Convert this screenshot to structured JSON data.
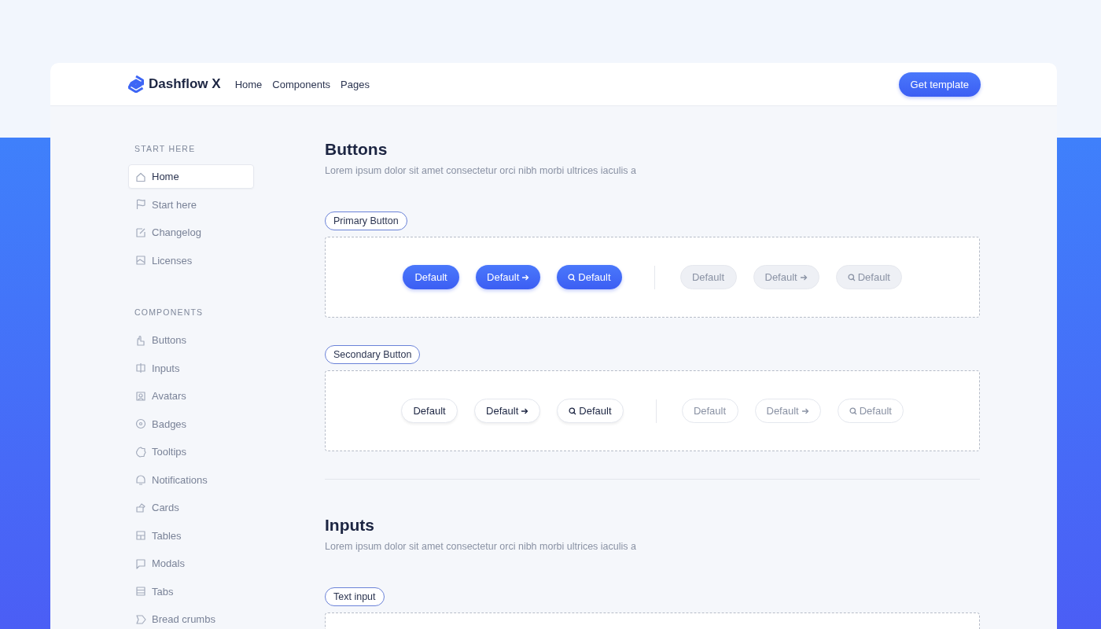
{
  "brand": {
    "name": "Dashflow X"
  },
  "nav": [
    {
      "label": "Home"
    },
    {
      "label": "Components"
    },
    {
      "label": "Pages"
    }
  ],
  "cta": {
    "label": "Get template"
  },
  "sidebar": [
    {
      "heading": "START HERE",
      "items": [
        {
          "label": "Home",
          "selected": true
        },
        {
          "label": "Start here",
          "selected": false
        },
        {
          "label": "Changelog",
          "selected": false
        },
        {
          "label": "Licenses",
          "selected": false
        }
      ]
    },
    {
      "heading": "COMPONENTS",
      "items": [
        {
          "label": "Buttons",
          "selected": false
        },
        {
          "label": "Inputs",
          "selected": false
        },
        {
          "label": "Avatars",
          "selected": false
        },
        {
          "label": "Badges",
          "selected": false
        },
        {
          "label": "Tooltips",
          "selected": false
        },
        {
          "label": "Notifications",
          "selected": false
        },
        {
          "label": "Cards",
          "selected": false
        },
        {
          "label": "Tables",
          "selected": false
        },
        {
          "label": "Modals",
          "selected": false
        },
        {
          "label": "Tabs",
          "selected": false
        },
        {
          "label": "Bread crumbs",
          "selected": false
        }
      ]
    }
  ],
  "sections": [
    {
      "title": "Buttons",
      "subtitle": "Lorem ipsum dolor sit amet consectetur orci nibh morbi ultrices iaculis a",
      "groups": [
        {
          "tag": "Primary Button",
          "kind": "primary",
          "buttons": [
            {
              "label": "Default",
              "kind": "plain",
              "disabled": false
            },
            {
              "label": "Default",
              "kind": "arrow",
              "disabled": false
            },
            {
              "label": "Default",
              "kind": "search",
              "disabled": false
            },
            {
              "label": "Default",
              "kind": "plain",
              "disabled": true
            },
            {
              "label": "Default",
              "kind": "arrow",
              "disabled": true
            },
            {
              "label": "Default",
              "kind": "search",
              "disabled": true
            }
          ]
        },
        {
          "tag": "Secondary Button",
          "kind": "secondary",
          "buttons": [
            {
              "label": "Default",
              "kind": "plain",
              "disabled": false
            },
            {
              "label": "Default",
              "kind": "arrow",
              "disabled": false
            },
            {
              "label": "Default",
              "kind": "search",
              "disabled": false
            },
            {
              "label": "Default",
              "kind": "plain",
              "disabled": true
            },
            {
              "label": "Default",
              "kind": "arrow",
              "disabled": true
            },
            {
              "label": "Default",
              "kind": "search",
              "disabled": true
            }
          ]
        }
      ]
    },
    {
      "title": "Inputs",
      "subtitle": "Lorem ipsum dolor sit amet consectetur orci nibh morbi ultrices iaculis a",
      "groups": [
        {
          "tag": "Text input",
          "kind": "input"
        }
      ]
    }
  ]
}
